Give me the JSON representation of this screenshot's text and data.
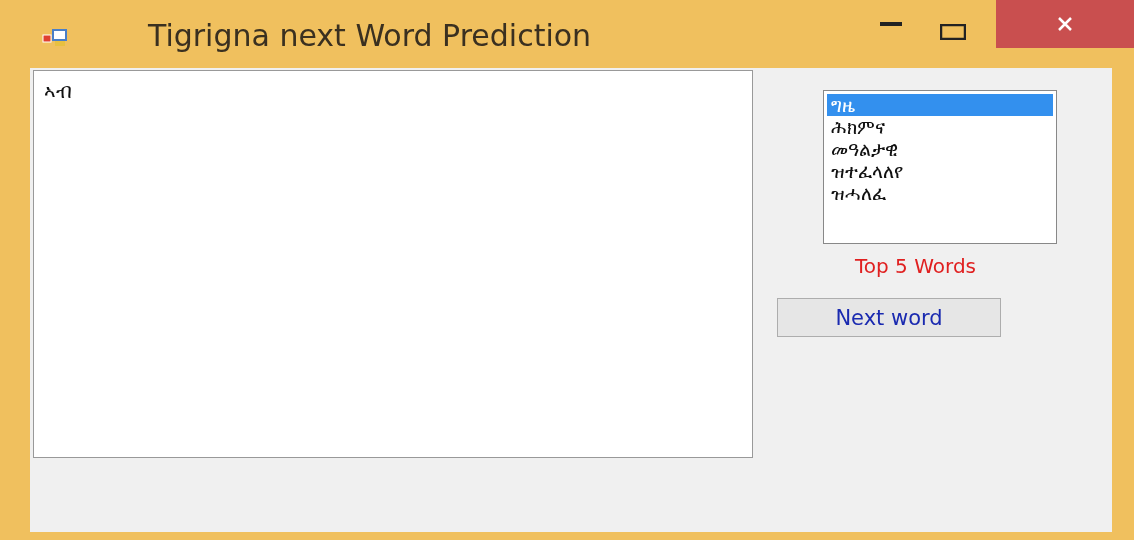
{
  "window": {
    "title": "Tigrigna next Word Prediction"
  },
  "editor": {
    "value": "ኣብ"
  },
  "suggestions": {
    "items": [
      {
        "label": "ግዜ",
        "selected": true
      },
      {
        "label": "ሕክምና",
        "selected": false
      },
      {
        "label": "መዓልታዊ",
        "selected": false
      },
      {
        "label": "ዝተፈላለየ",
        "selected": false
      },
      {
        "label": "ዝሓለፈ",
        "selected": false
      }
    ],
    "caption": "Top 5 Words"
  },
  "buttons": [
    {
      "label": "Next word"
    }
  ]
}
